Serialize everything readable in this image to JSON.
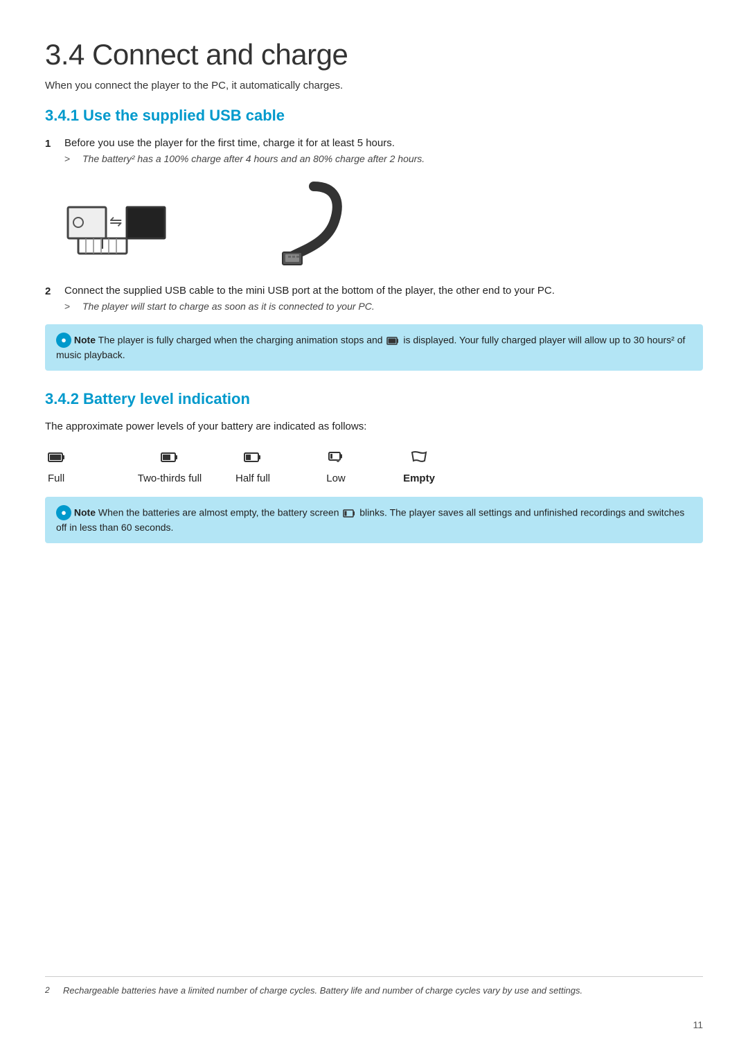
{
  "page": {
    "title": "3.4  Connect and charge",
    "intro": "When you connect the player to the PC, it automatically charges.",
    "section1": {
      "title": "3.4.1  Use the supplied USB cable",
      "step1": {
        "number": "1",
        "text": "Before you use the player for the first time, charge it for at least 5 hours.",
        "subnote": "The battery² has a 100% charge after 4 hours and an 80% charge after 2 hours."
      },
      "step2": {
        "number": "2",
        "text": "Connect the supplied USB cable to the mini USB port at the bottom of the player, the other end to your PC.",
        "subnote": "The player will start to charge as soon as it is connected to your PC."
      },
      "note1": {
        "label": "Note",
        "text": "The player is fully charged when the charging animation stops and",
        "text2": "is displayed. Your fully charged player will allow up to 30 hours² of music playback."
      }
    },
    "section2": {
      "title": "3.4.2  Battery level indication",
      "intro": "The approximate power levels of your battery are indicated as follows:",
      "battery_levels": [
        {
          "label": "Full",
          "icon_type": "full"
        },
        {
          "label": "Two-thirds full",
          "icon_type": "twothirds"
        },
        {
          "label": "Half full",
          "icon_type": "half"
        },
        {
          "label": "Low",
          "icon_type": "low"
        },
        {
          "label": "Empty",
          "icon_type": "empty"
        }
      ],
      "note2": {
        "label": "Note",
        "text": "When the batteries are almost empty, the battery screen",
        "text2": "blinks. The player saves all settings and unfinished recordings and switches off in less than 60 seconds."
      }
    },
    "footnote": "Rechargeable batteries have a limited number of charge cycles. Battery life and number of charge cycles vary by use and settings.",
    "footnote_num": "2",
    "page_number": "11"
  }
}
